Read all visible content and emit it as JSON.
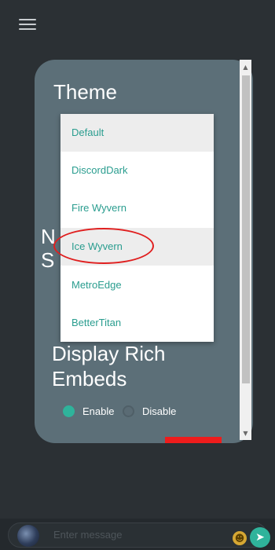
{
  "header": {
    "menu_icon": "hamburger-menu-icon"
  },
  "settings_panel": {
    "theme_title": "Theme",
    "partial_label": "N\nS",
    "rich_embeds_title": "Display Rich Embeds",
    "rich_embeds_options": [
      {
        "label": "Enable",
        "selected": true
      },
      {
        "label": "Disable",
        "selected": false
      }
    ]
  },
  "theme_dropdown": {
    "options": [
      "Default",
      "DiscordDark",
      "Fire Wyvern",
      "Ice Wyvern",
      "MetroEdge",
      "BetterTitan"
    ],
    "highlighted": "Ice Wyvern"
  },
  "composer": {
    "placeholder": "Enter message",
    "emoji_icon": "emoji-icon",
    "send_icon": "send-icon"
  },
  "colors": {
    "accent": "#2fb39b",
    "panel": "#5c6f78",
    "background": "#2b3034",
    "annotation": "#e01f1f"
  }
}
